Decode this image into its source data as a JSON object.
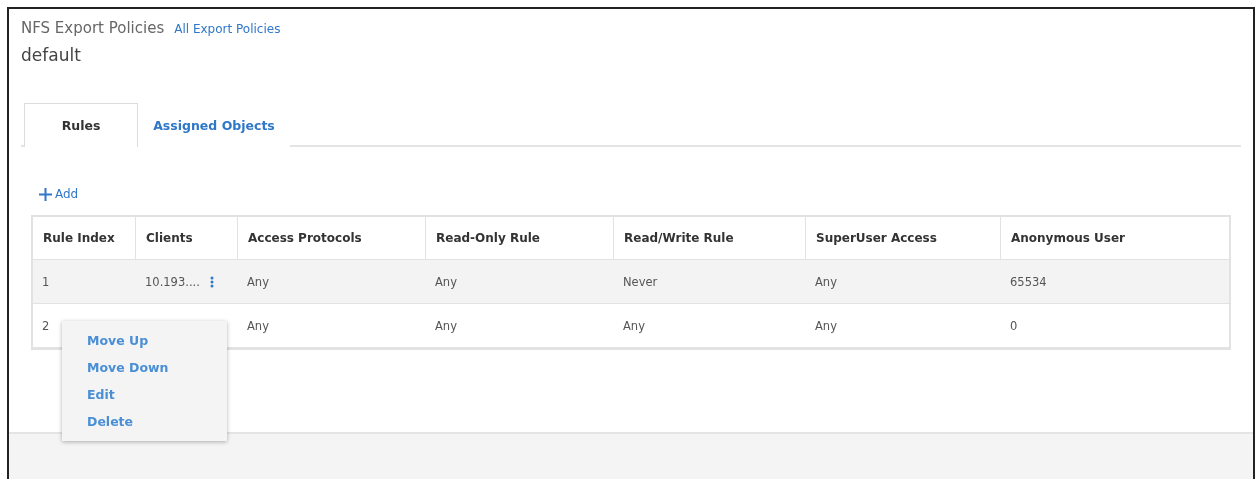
{
  "breadcrumb": {
    "title": "NFS Export Policies",
    "link": "All Export Policies"
  },
  "heading": "default",
  "tabs": [
    {
      "label": "Rules",
      "selected": true
    },
    {
      "label": "Assigned Objects",
      "selected": false
    }
  ],
  "add_button": "Add",
  "table": {
    "columns": [
      "Rule Index",
      "Clients",
      "Access Protocols",
      "Read-Only Rule",
      "Read/Write Rule",
      "SuperUser Access",
      "Anonymous User"
    ],
    "rows": [
      {
        "selected": true,
        "cells": [
          "1",
          "10.193....",
          "Any",
          "Any",
          "Never",
          "Any",
          "65534"
        ]
      },
      {
        "selected": false,
        "cells": [
          "2",
          "",
          "Any",
          "Any",
          "Any",
          "Any",
          "0"
        ]
      }
    ]
  },
  "context_menu": [
    "Move Up",
    "Move Down",
    "Edit",
    "Delete"
  ]
}
